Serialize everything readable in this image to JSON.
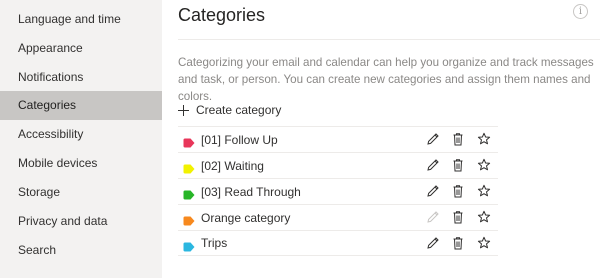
{
  "sidebar": {
    "items": [
      {
        "label": "Language and time"
      },
      {
        "label": "Appearance"
      },
      {
        "label": "Notifications"
      },
      {
        "label": "Categories"
      },
      {
        "label": "Accessibility"
      },
      {
        "label": "Mobile devices"
      },
      {
        "label": "Storage"
      },
      {
        "label": "Privacy and data"
      },
      {
        "label": "Search"
      }
    ],
    "selected": "Categories"
  },
  "main": {
    "title": "Categories",
    "info_icon": "info-icon",
    "description": "Categorizing your email and calendar can help you organize and track messages and task, or person. You can create new categories and assign them names and colors.",
    "create_label": "Create category"
  },
  "categories": [
    {
      "name": "[01] Follow Up",
      "color": "#e8365a",
      "edit_enabled": true
    },
    {
      "name": "[02] Waiting",
      "color": "#f2f200",
      "edit_enabled": true
    },
    {
      "name": "[03] Read Through",
      "color": "#27b527",
      "edit_enabled": true
    },
    {
      "name": "Orange category",
      "color": "#f7891e",
      "edit_enabled": false
    },
    {
      "name": "Trips",
      "color": "#2bb7e0",
      "edit_enabled": true
    }
  ],
  "colors": {
    "sidebar_bg": "#f3f2f1",
    "selected_bg": "#c8c6c4",
    "description_text": "#8a8886"
  }
}
